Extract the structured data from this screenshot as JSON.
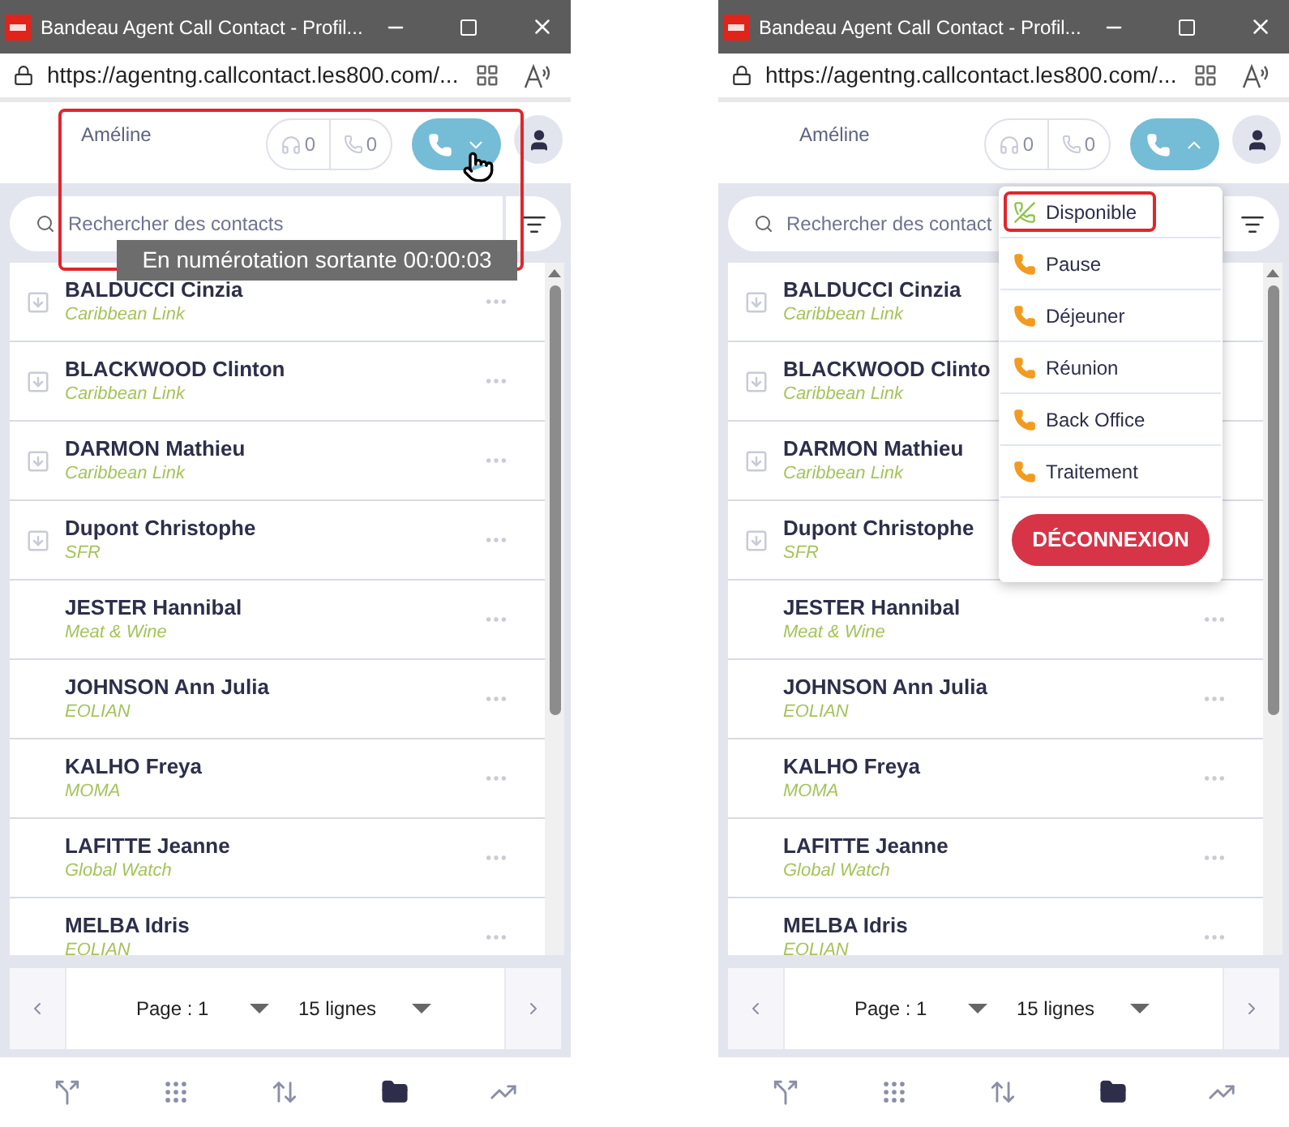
{
  "panels": [
    {
      "window": {
        "title": "Bandeau Agent Call Contact - Profil...",
        "url": "https://agentng.callcontact.les800.com/..."
      },
      "header": {
        "agent": "Améline",
        "counters": [
          "0",
          "0"
        ],
        "menu_expanded": false,
        "cursor_visible": true,
        "highlighted": true
      },
      "tooltip": "En numérotation sortante 00:00:03",
      "search": {
        "placeholder": "Rechercher des contacts"
      },
      "contacts": [
        {
          "name": "BALDUCCI Cinzia",
          "company": "Caribbean Link",
          "imported": true,
          "more": true
        },
        {
          "name": "BLACKWOOD Clinton",
          "company": "Caribbean Link",
          "imported": true,
          "more": true
        },
        {
          "name": "DARMON Mathieu",
          "company": "Caribbean Link",
          "imported": true,
          "more": true
        },
        {
          "name": "Dupont Christophe",
          "company": "SFR",
          "imported": true,
          "more": true
        },
        {
          "name": "JESTER Hannibal",
          "company": "Meat & Wine",
          "imported": false,
          "more": true
        },
        {
          "name": "JOHNSON Ann Julia",
          "company": "EOLIAN",
          "imported": false,
          "more": true
        },
        {
          "name": "KALHO Freya",
          "company": "MOMA",
          "imported": false,
          "more": true
        },
        {
          "name": "LAFITTE Jeanne",
          "company": "Global Watch",
          "imported": false,
          "more": true
        },
        {
          "name": "MELBA Idris",
          "company": "EOLIAN",
          "imported": false,
          "more": true
        }
      ],
      "pagination": {
        "page": "Page : 1",
        "rows": "15 lignes"
      },
      "nav": [
        {
          "kind": "transfer",
          "selected": false
        },
        {
          "kind": "dialpad",
          "selected": false
        },
        {
          "kind": "history",
          "selected": false
        },
        {
          "kind": "contacts",
          "selected": true
        },
        {
          "kind": "stats",
          "selected": false
        }
      ]
    },
    {
      "window": {
        "title": "Bandeau Agent Call Contact - Profil...",
        "url": "https://agentng.callcontact.les800.com/..."
      },
      "header": {
        "agent": "Améline",
        "counters": [
          "0",
          "0"
        ],
        "menu_expanded": true,
        "cursor_visible": false,
        "highlighted": false
      },
      "search": {
        "placeholder": "Rechercher des contact"
      },
      "status_menu": {
        "items": [
          {
            "label": "Disponible",
            "kind": "available",
            "highlighted": true
          },
          {
            "label": "Pause",
            "kind": "pause",
            "highlighted": false
          },
          {
            "label": "Déjeuner",
            "kind": "pause",
            "highlighted": false
          },
          {
            "label": "Réunion",
            "kind": "pause",
            "highlighted": false
          },
          {
            "label": "Back Office",
            "kind": "pause",
            "highlighted": false
          },
          {
            "label": "Traitement",
            "kind": "pause",
            "highlighted": false
          }
        ],
        "logout": "DÉCONNEXION"
      },
      "contacts": [
        {
          "name": "BALDUCCI Cinzia",
          "company": "Caribbean Link",
          "imported": true,
          "more": false
        },
        {
          "name": "BLACKWOOD Clinto",
          "company": "Caribbean Link",
          "imported": true,
          "more": false
        },
        {
          "name": "DARMON Mathieu",
          "company": "Caribbean Link",
          "imported": true,
          "more": false
        },
        {
          "name": "Dupont Christophe",
          "company": "SFR",
          "imported": true,
          "more": false
        },
        {
          "name": "JESTER Hannibal",
          "company": "Meat & Wine",
          "imported": false,
          "more": true
        },
        {
          "name": "JOHNSON Ann Julia",
          "company": "EOLIAN",
          "imported": false,
          "more": true
        },
        {
          "name": "KALHO Freya",
          "company": "MOMA",
          "imported": false,
          "more": true
        },
        {
          "name": "LAFITTE Jeanne",
          "company": "Global Watch",
          "imported": false,
          "more": true
        },
        {
          "name": "MELBA Idris",
          "company": "EOLIAN",
          "imported": false,
          "more": true
        }
      ],
      "pagination": {
        "page": "Page : 1",
        "rows": "15 lignes"
      },
      "nav": [
        {
          "kind": "transfer",
          "selected": false
        },
        {
          "kind": "dialpad",
          "selected": false
        },
        {
          "kind": "history",
          "selected": false
        },
        {
          "kind": "contacts",
          "selected": true
        },
        {
          "kind": "stats",
          "selected": false
        }
      ]
    }
  ]
}
